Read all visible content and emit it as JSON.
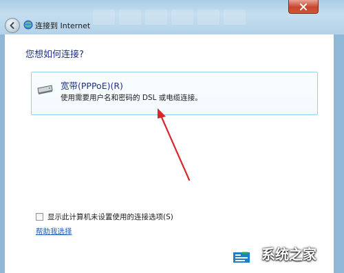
{
  "window": {
    "title": "连接到 Internet"
  },
  "dialog": {
    "heading": "您想如何连接?",
    "option": {
      "title": "宽带(PPPoE)(R)",
      "description": "使用需要用户名和密码的 DSL 或电缆连接。"
    },
    "show_options": {
      "label": "显示此计算机未设置使用的连接选项(S)",
      "checked": false
    },
    "help_link": "帮助我选择"
  },
  "watermark": {
    "text": "系统之家"
  },
  "colors": {
    "heading": "#1e3287",
    "option_border": "#8fd3f1",
    "link": "#1d5bb9",
    "annotation_arrow": "#d8262a",
    "close_button": "#c9452d"
  }
}
